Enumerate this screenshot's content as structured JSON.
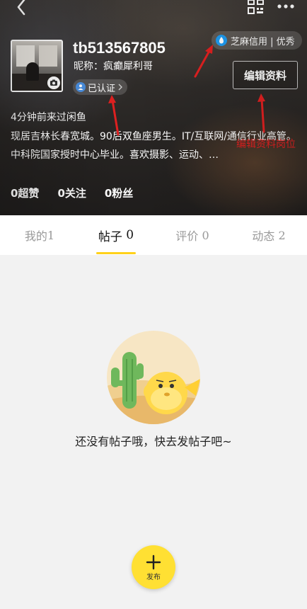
{
  "header": {
    "username": "tb513567805",
    "nickname": "昵称：疯癫犀利哥",
    "verified_label": "已认证",
    "credit_label": "芝麻信用 | 优秀",
    "edit_label": "编辑资料",
    "last_seen": "4分钟前来过闲鱼",
    "bio": "现居吉林长春宽城。90后双鱼座男生。IT/互联网/通信行业高管。中科院国家授时中心毕业。喜欢摄影、运动、…",
    "stats": [
      {
        "label": "0超赞"
      },
      {
        "label": "0关注"
      },
      {
        "label": "0粉丝"
      }
    ],
    "annotation_label": "编辑资料岗位"
  },
  "tabs": [
    {
      "label": "我的",
      "count": "1"
    },
    {
      "label": "帖子",
      "count": "0",
      "active": true
    },
    {
      "label": "评价",
      "count": "0"
    },
    {
      "label": "动态",
      "count": "2"
    }
  ],
  "empty_state": {
    "message": "还没有帖子哦，快去发帖子吧~"
  },
  "publish": {
    "label": "发布"
  },
  "colors": {
    "accent_yellow": "#ffd11a",
    "publish_yellow": "#ffe033",
    "annotation_red": "#e02020"
  },
  "icons": [
    "back-icon",
    "qr-code-icon",
    "more-icon",
    "camera-icon",
    "verified-icon",
    "chevron-right-icon",
    "sesame-credit-icon",
    "plus-icon"
  ]
}
